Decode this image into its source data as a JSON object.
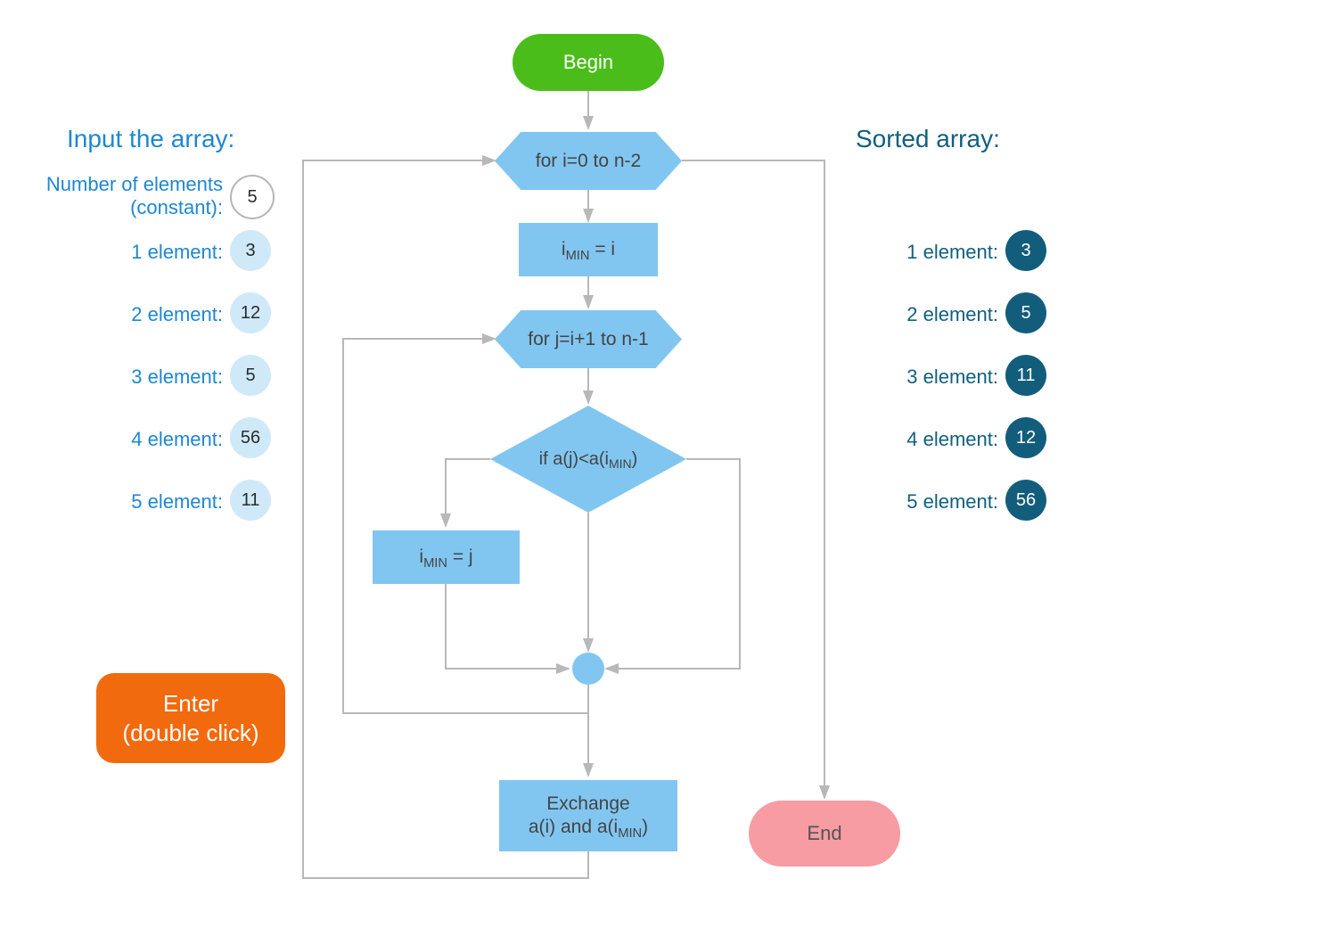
{
  "left": {
    "title": "Input the array:",
    "constLabel1": "Number of elements",
    "constLabel2": "(constant):",
    "constValue": "5",
    "items": [
      {
        "label": "1 element:",
        "value": "3"
      },
      {
        "label": "2 element:",
        "value": "12"
      },
      {
        "label": "3 element:",
        "value": "5"
      },
      {
        "label": "4 element:",
        "value": "56"
      },
      {
        "label": "5 element:",
        "value": "11"
      }
    ],
    "enterLine1": "Enter",
    "enterLine2": "(double click)"
  },
  "right": {
    "title": "Sorted array:",
    "items": [
      {
        "label": "1 element:",
        "value": "3"
      },
      {
        "label": "2 element:",
        "value": "5"
      },
      {
        "label": "3 element:",
        "value": "11"
      },
      {
        "label": "4 element:",
        "value": "12"
      },
      {
        "label": "5 element:",
        "value": "56"
      }
    ]
  },
  "flow": {
    "begin": "Begin",
    "loopI": "for i=0 to n-2",
    "iminI_pre": "i",
    "iminI_sub": "MIN",
    "iminI_post": " = i",
    "loopJ": "for j=i+1 to n-1",
    "cond_pre": "if a(j)<a(i",
    "cond_sub": "MIN",
    "cond_post": ")",
    "iminJ_pre": "i",
    "iminJ_sub": "MIN",
    "iminJ_post": " = j",
    "exch_l1": "Exchange",
    "exch_l2pre": "a(i) and a(i",
    "exch_l2sub": "MIN",
    "exch_l2post": ")",
    "end": "End"
  }
}
